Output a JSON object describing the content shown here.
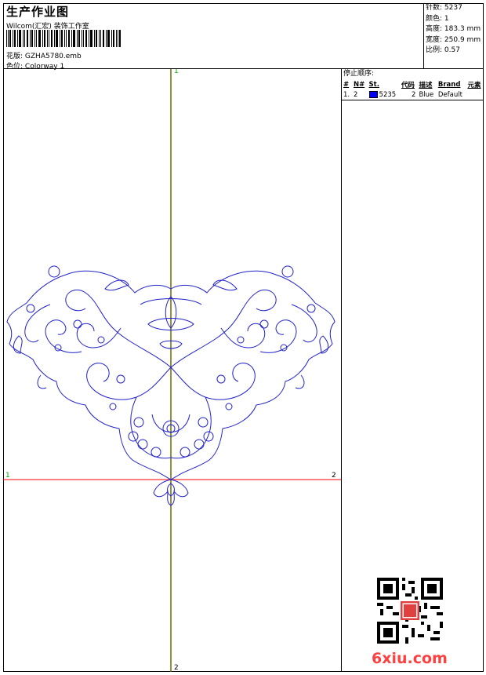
{
  "header": {
    "title": "生产作业图",
    "studio": "Wilcom(汇宏) 装饰工作室",
    "file_label": "花版:",
    "file_value": "GZHA5780.emb",
    "colorway_label": "色位:",
    "colorway_value": "Colorway 1"
  },
  "stats": [
    {
      "label": "针数:",
      "value": "5237"
    },
    {
      "label": "颜色:",
      "value": "1"
    },
    {
      "label": "高度:",
      "value": "183.3 mm"
    },
    {
      "label": "宽度:",
      "value": "250.9 mm"
    },
    {
      "label": "比例:",
      "value": "0.57"
    }
  ],
  "stop_sequence": {
    "title": "停止顺序:",
    "columns": [
      "#",
      "N#",
      "St.",
      "代码",
      "描述",
      "Brand",
      "元素"
    ],
    "rows": [
      {
        "index": "1.",
        "needle": "2",
        "stitches": "5235",
        "code": "2",
        "description": "Blue",
        "brand": "Default",
        "color": "#0000ff"
      }
    ]
  },
  "axes": {
    "v_top": "1",
    "v_bottom": "2",
    "h_left": "1",
    "h_right": "2"
  },
  "watermark": {
    "text": "6xiu.com",
    "color": "#ff4040"
  },
  "colors": {
    "design": "#2222cc",
    "v_axis": "#6b6b00",
    "h_axis": "#ff0000",
    "axis_label": "#00aa00"
  }
}
